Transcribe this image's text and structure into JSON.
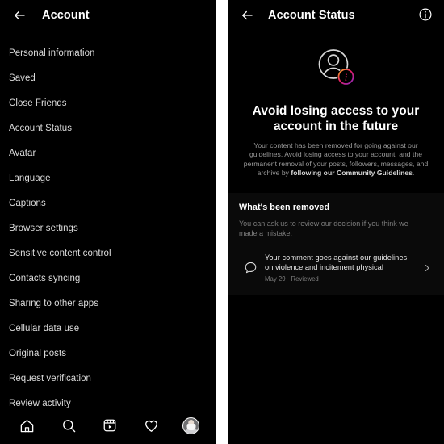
{
  "left_screen": {
    "header": {
      "back_icon": "arrow-left-icon",
      "title": "Account"
    },
    "settings_items": [
      "Personal information",
      "Saved",
      "Close Friends",
      "Account Status",
      "Avatar",
      "Language",
      "Captions",
      "Browser settings",
      "Sensitive content control",
      "Contacts syncing",
      "Sharing to other apps",
      "Cellular data use",
      "Original posts",
      "Request verification",
      "Review activity"
    ],
    "navbar": [
      {
        "icon": "home-icon"
      },
      {
        "icon": "search-icon"
      },
      {
        "icon": "reels-icon"
      },
      {
        "icon": "heart-icon"
      },
      {
        "icon": "profile-avatar"
      }
    ]
  },
  "right_screen": {
    "header": {
      "back_icon": "arrow-left-icon",
      "title": "Account Status",
      "info_icon": "info-circle-icon"
    },
    "hero": {
      "avatar_icon": "profile-circle-icon",
      "badge_icon": "info-badge-icon",
      "badge_letter": "i",
      "headline": "Avoid losing access to your account in the future",
      "body_plain_1": "Your content has been removed for going against our guidelines. Avoid losing access to your account, and the permanent removal of your posts, followers, messages, and archive by ",
      "body_bold": "following our Community Guidelines",
      "body_plain_2": "."
    },
    "removed_section": {
      "title": "What's been removed",
      "subtitle": "You can ask us to review our decision if you think we made a mistake.",
      "rows": [
        {
          "icon": "comment-bubble-icon",
          "title": "Your comment goes against our guidelines on violence and incitement physical",
          "date": "May 29",
          "separator": "·",
          "status": "Reviewed",
          "chevron": "chevron-right-icon"
        }
      ]
    }
  },
  "colors": {
    "background": "#000000",
    "panel": "#0a0a0a",
    "text_primary": "#ffffff",
    "text_secondary": "#9a9a9a",
    "badge_gradient_start": "#f9a825",
    "badge_gradient_mid": "#e91e63",
    "badge_gradient_end": "#9c27b0",
    "divider": "#ffffff"
  }
}
